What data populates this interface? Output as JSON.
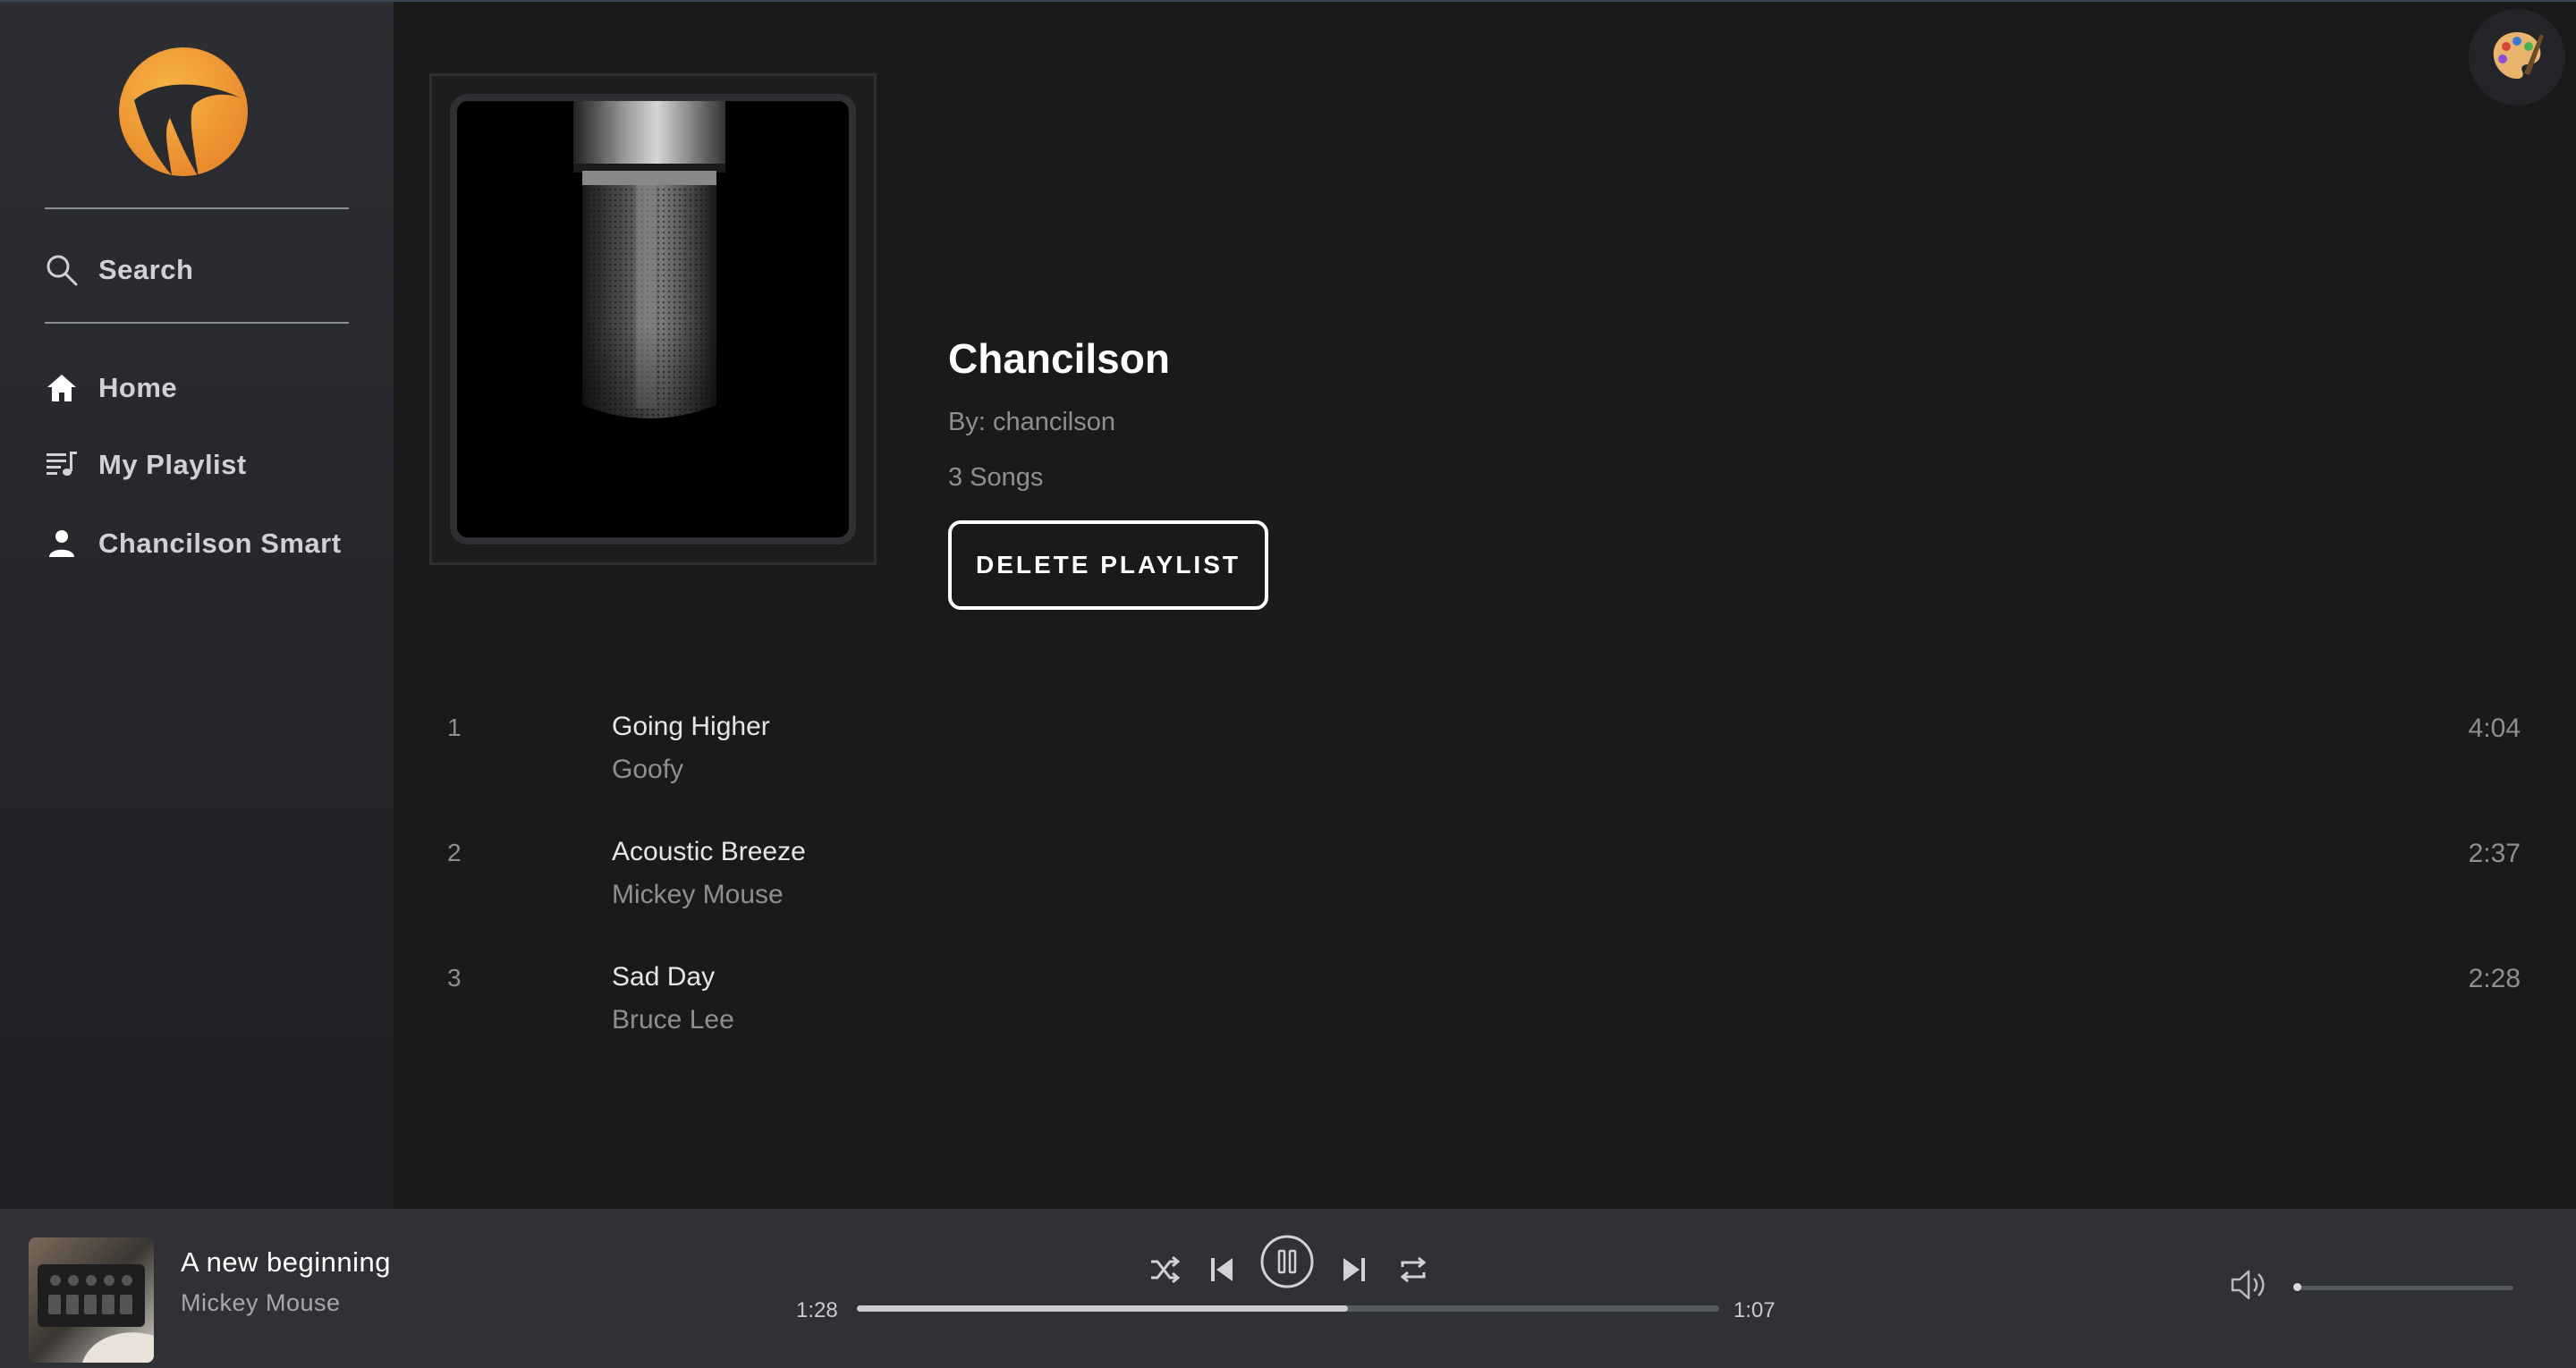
{
  "sidebar": {
    "logo_icon": "brand-logo-icon",
    "items": [
      {
        "label": "Search",
        "icon": "search-icon"
      },
      {
        "label": "Home",
        "icon": "home-icon"
      },
      {
        "label": "My Playlist",
        "icon": "playlist-icon"
      },
      {
        "label": "Chancilson Smart",
        "icon": "user-icon"
      }
    ]
  },
  "header": {
    "theme_button_icon": "palette-icon"
  },
  "playlist": {
    "title": "Chancilson",
    "by": "By: chancilson",
    "count": "3 Songs",
    "delete_label": "DELETE PLAYLIST"
  },
  "tracks": [
    {
      "num": "1",
      "title": "Going Higher",
      "artist": "Goofy",
      "duration": "4:04"
    },
    {
      "num": "2",
      "title": "Acoustic Breeze",
      "artist": "Mickey Mouse",
      "duration": "2:37"
    },
    {
      "num": "3",
      "title": "Sad Day",
      "artist": "Bruce Lee",
      "duration": "2:28"
    }
  ],
  "player": {
    "title": "A new beginning",
    "artist": "Mickey Mouse",
    "elapsed": "1:28",
    "remaining": "1:07",
    "progress": 0.57,
    "volume": 0.0
  },
  "colors": {
    "brand_orange": "#f0a030",
    "background": "#1a1a1b",
    "sidebar": "#2c2e33",
    "player_bar": "#2f3135"
  }
}
